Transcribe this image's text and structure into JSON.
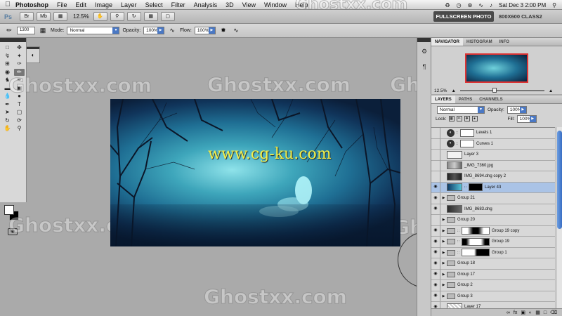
{
  "menubar": {
    "app_name": "Photoshop",
    "menus": [
      "File",
      "Edit",
      "Image",
      "Layer",
      "Select",
      "Filter",
      "Analysis",
      "3D",
      "View",
      "Window",
      "Help"
    ],
    "clock": "Sat Dec 3  2:00 PM"
  },
  "appbar": {
    "logo": "Ps",
    "bridge": "Br",
    "minibridge": "Mb",
    "zoom": "12.5%",
    "workspace_active": "FULLSCREEN PHOTO",
    "workspace_other": "800X600 CLASS2"
  },
  "options": {
    "brush_size": "1300",
    "mode_label": "Mode:",
    "mode_value": "Normal",
    "opacity_label": "Opacity:",
    "opacity_value": "100%",
    "flow_label": "Flow:",
    "flow_value": "100%"
  },
  "canvas": {
    "url_watermark": "www.cg-ku.com"
  },
  "watermark": "Ghostxx.com",
  "navigator": {
    "tabs": [
      "NAVIGATOR",
      "HISTOGRAM",
      "INFO"
    ],
    "zoom": "12.5%"
  },
  "layers_panel": {
    "tabs": [
      "LAYERS",
      "PATHS",
      "CHANNELS"
    ],
    "blend_mode": "Normal",
    "opacity_label": "Opacity:",
    "opacity_value": "100%",
    "lock_label": "Lock:",
    "fill_label": "Fill:",
    "fill_value": "100%",
    "layers": [
      {
        "name": "Levels 1",
        "kind": "adjustment",
        "visible": false
      },
      {
        "name": "Curves 1",
        "kind": "adjustment",
        "visible": false
      },
      {
        "name": "Layer 3",
        "kind": "pixel",
        "visible": false
      },
      {
        "name": "_IMG_7360.jpg",
        "kind": "pixel",
        "visible": false
      },
      {
        "name": "IMG_8694.dng copy 2",
        "kind": "pixel",
        "visible": false
      },
      {
        "name": "Layer 43",
        "kind": "masked",
        "visible": true,
        "selected": true
      },
      {
        "name": "Group 21",
        "kind": "group",
        "visible": true
      },
      {
        "name": "IMG_8683.dng",
        "kind": "pixel",
        "visible": true
      },
      {
        "name": "Group 20",
        "kind": "group",
        "visible": false
      },
      {
        "name": "Group 19 copy",
        "kind": "group-mask",
        "visible": true
      },
      {
        "name": "Group 19",
        "kind": "group-mask",
        "visible": true
      },
      {
        "name": "Group 1",
        "kind": "group-mask",
        "visible": true
      },
      {
        "name": "Group 18",
        "kind": "group",
        "visible": true
      },
      {
        "name": "Group 17",
        "kind": "group",
        "visible": true
      },
      {
        "name": "Group 2",
        "kind": "group",
        "visible": true
      },
      {
        "name": "Group 3",
        "kind": "group",
        "visible": true
      },
      {
        "name": "Layer 17",
        "kind": "pixel",
        "visible": true
      }
    ]
  }
}
